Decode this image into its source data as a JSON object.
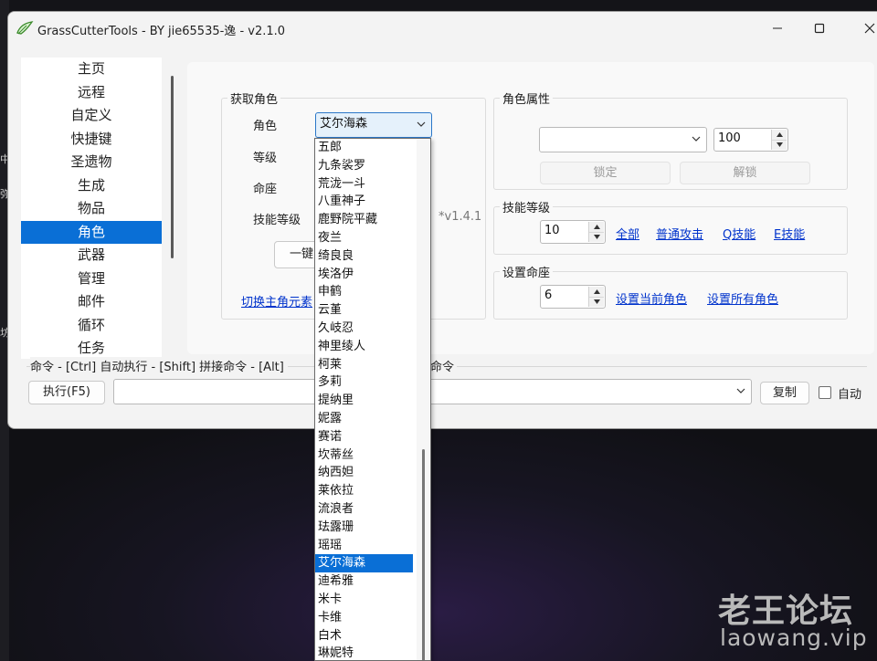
{
  "window": {
    "title": "GrassCutterTools  -  BY jie65535-逸  -  v2.1.0"
  },
  "sidebar": {
    "items": [
      "主页",
      "远程",
      "自定义",
      "快捷键",
      "圣遗物",
      "生成",
      "物品",
      "角色",
      "武器",
      "管理",
      "邮件",
      "循环",
      "任务"
    ],
    "active_index": 7
  },
  "get_character": {
    "legend": "获取角色",
    "character_label": "角色",
    "character_value": "艾尔海森",
    "level_label": "等级",
    "constellation_label": "命座",
    "skill_level_label": "技能等级",
    "one_key_button": "一键",
    "switch_link": "切换主角元素",
    "version_hint": "*v1.4.1"
  },
  "character_props": {
    "legend": "角色属性",
    "prop_select_value": "",
    "prop_value": "100",
    "lock_button": "锁定",
    "unlock_button": "解锁"
  },
  "skill_level": {
    "legend": "技能等级",
    "value": "10",
    "links": [
      "全部",
      "普通攻击",
      "Q技能",
      "E技能"
    ]
  },
  "set_constellation": {
    "legend": "设置命座",
    "value": "6",
    "links": [
      "设置当前角色",
      "设置所有角色"
    ]
  },
  "command": {
    "legend_left": "命令  - [Ctrl] 自动执行  - [Shift] 拼接命令  - [Alt]",
    "legend_right": "接命令",
    "execute_button": "执行(F5)",
    "input_value": "",
    "copy_button": "复制",
    "auto_label": "自动",
    "auto_checked": false
  },
  "dropdown": {
    "items": [
      "五郎",
      "九条裟罗",
      "荒泷一斗",
      "八重神子",
      "鹿野院平藏",
      "夜兰",
      "绮良良",
      "埃洛伊",
      "申鹤",
      "云堇",
      "久岐忍",
      "神里绫人",
      "柯莱",
      "多莉",
      "提纳里",
      "妮露",
      "赛诺",
      "坎蒂丝",
      "纳西妲",
      "莱依拉",
      "流浪者",
      "珐露珊",
      "瑶瑶",
      "艾尔海森",
      "迪希雅",
      "米卡",
      "卡维",
      "白术",
      "琳妮特"
    ],
    "selected_index": 23
  },
  "background": {
    "edge_glyphs": [
      "中",
      "弥",
      "坊"
    ]
  },
  "watermark": {
    "main": "老王论坛",
    "sub": "laowang.vip"
  },
  "colors": {
    "accent": "#0a6fd6",
    "link": "#0033cc"
  }
}
